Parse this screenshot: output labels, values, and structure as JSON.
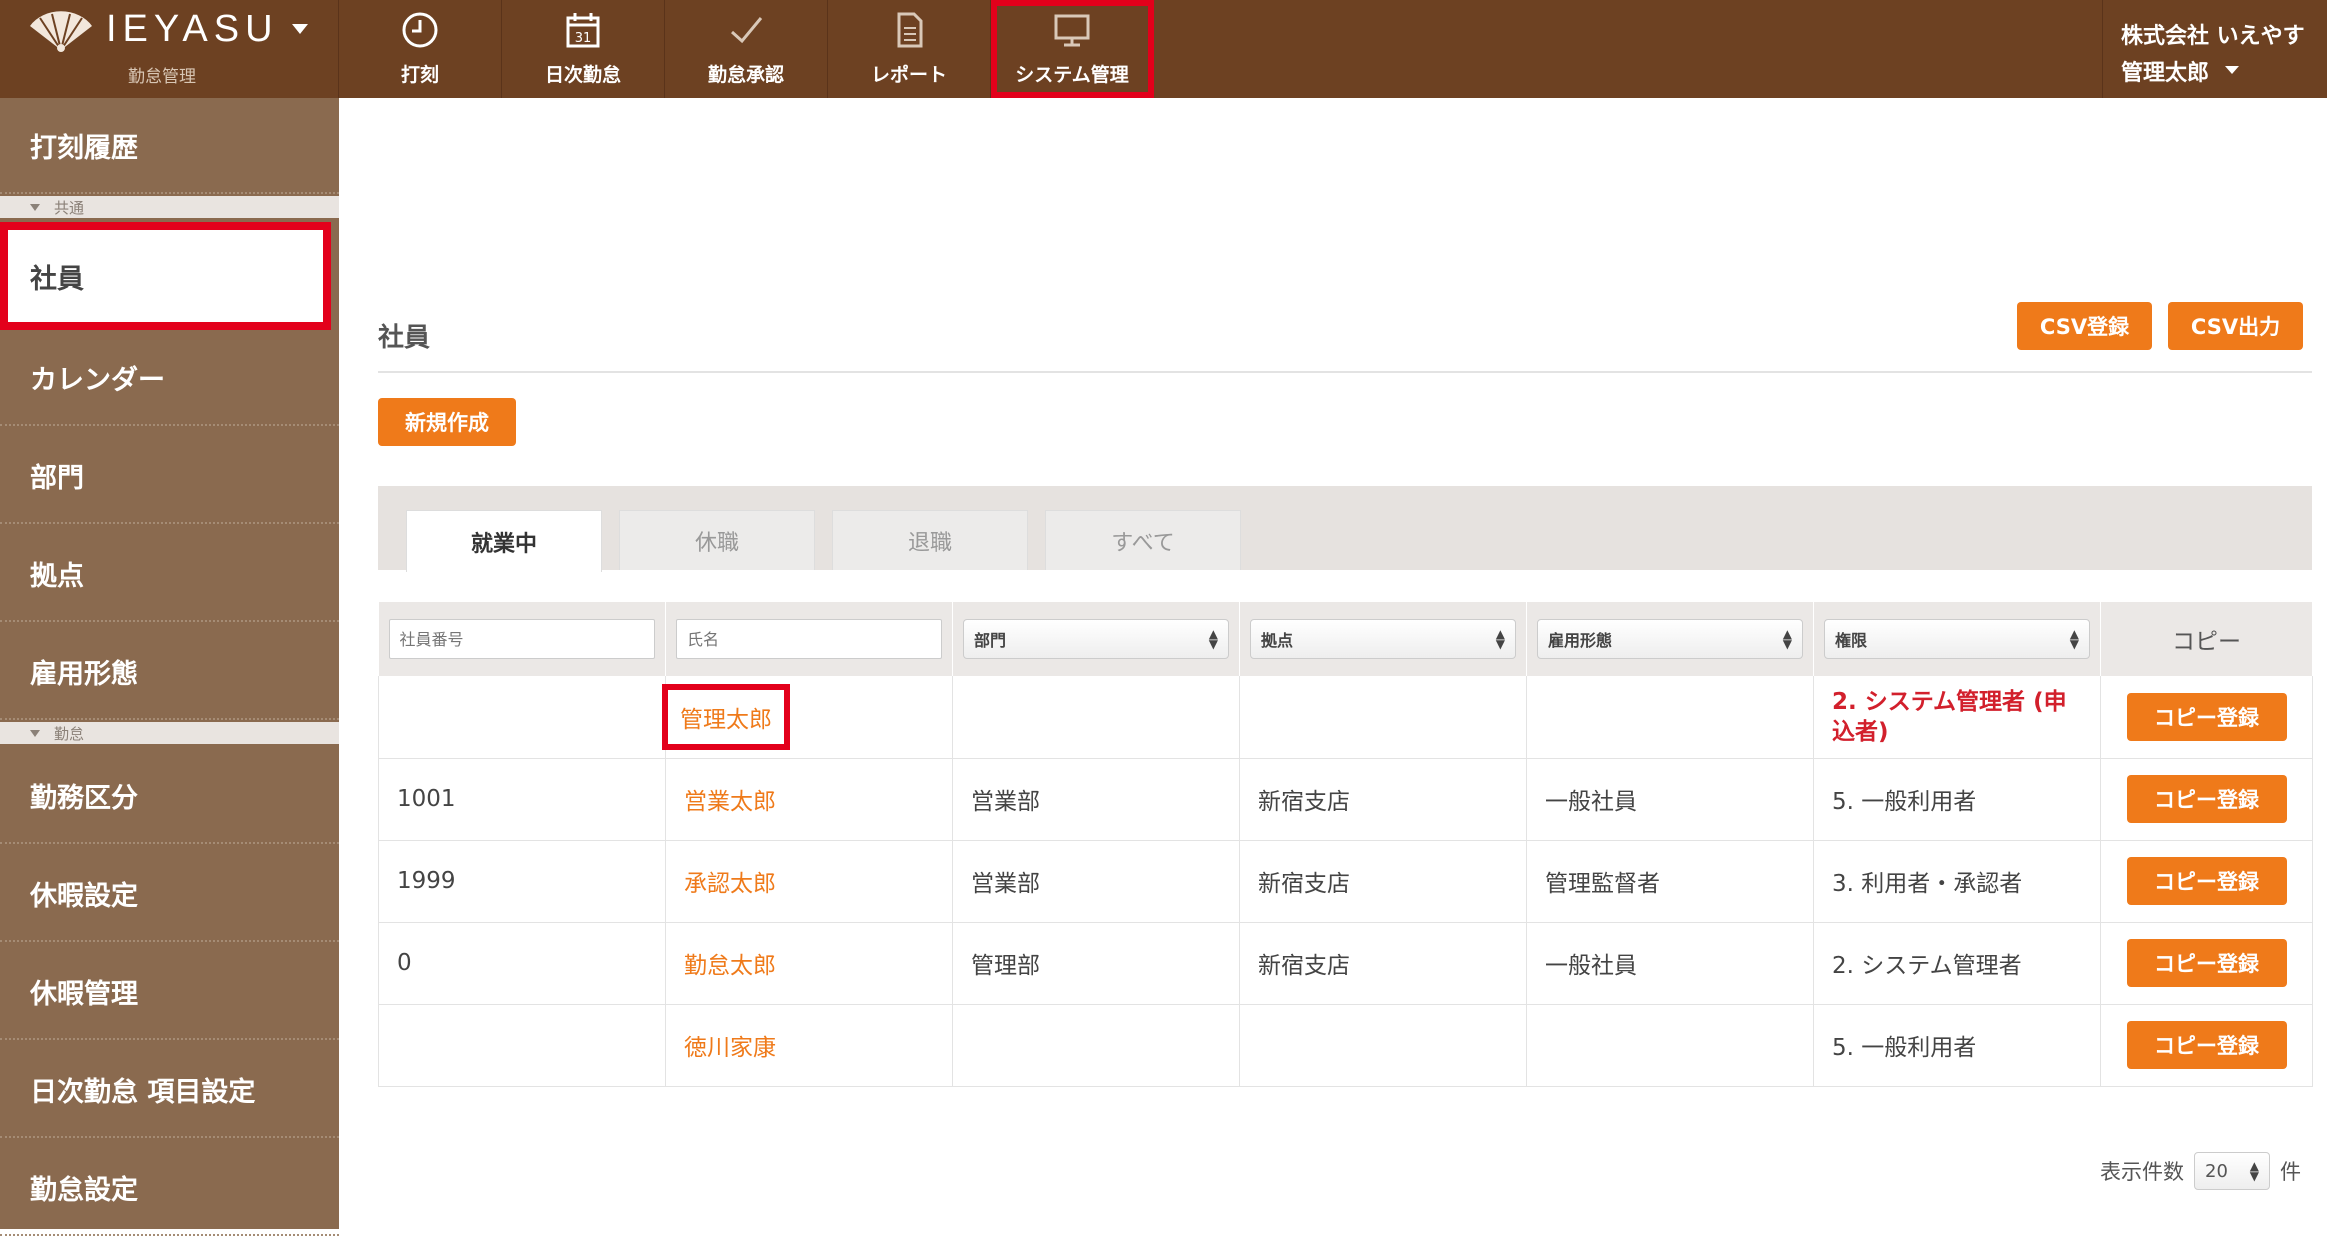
{
  "brand": {
    "name": "IEYASU",
    "subtitle": "勤怠管理"
  },
  "nav": [
    {
      "label": "打刻",
      "icon": "clock-icon"
    },
    {
      "label": "日次勤怠",
      "icon": "calendar-icon",
      "calendar_day": "31"
    },
    {
      "label": "勤怠承認",
      "icon": "check-icon"
    },
    {
      "label": "レポート",
      "icon": "document-icon"
    },
    {
      "label": "システム管理",
      "icon": "monitor-icon",
      "active": true
    }
  ],
  "user": {
    "company": "株式会社 いえやす",
    "name": "管理太郎"
  },
  "sidebar": {
    "top_item": "打刻履歴",
    "section_common": "共通",
    "items_common": [
      "社員",
      "カレンダー",
      "部門",
      "拠点",
      "雇用形態"
    ],
    "section_attendance": "勤怠",
    "items_attendance": [
      "勤務区分",
      "休暇設定",
      "休暇管理",
      "日次勤怠 項目設定",
      "勤怠設定"
    ]
  },
  "page": {
    "title": "社員",
    "csv_import": "CSV登録",
    "csv_export": "CSV出力",
    "new_button": "新規作成"
  },
  "tabs": [
    "就業中",
    "休職",
    "退職",
    "すべて"
  ],
  "filters": {
    "employee_no_placeholder": "社員番号",
    "name_placeholder": "氏名",
    "department": "部門",
    "location": "拠点",
    "employment_type": "雇用形態",
    "authority": "権限",
    "copy_header": "コピー"
  },
  "rows": [
    {
      "no": "",
      "name": "管理太郎",
      "dept": "",
      "location": "",
      "type": "",
      "role": "2. システム管理者 (申込者)",
      "copy": "コピー登録"
    },
    {
      "no": "1001",
      "name": "営業太郎",
      "dept": "営業部",
      "location": "新宿支店",
      "type": "一般社員",
      "role": "5. 一般利用者",
      "copy": "コピー登録"
    },
    {
      "no": "1999",
      "name": "承認太郎",
      "dept": "営業部",
      "location": "新宿支店",
      "type": "管理監督者",
      "role": "3. 利用者・承認者",
      "copy": "コピー登録"
    },
    {
      "no": "0",
      "name": "勤怠太郎",
      "dept": "管理部",
      "location": "新宿支店",
      "type": "一般社員",
      "role": "2. システム管理者",
      "copy": "コピー登録"
    },
    {
      "no": "",
      "name": "徳川家康",
      "dept": "",
      "location": "",
      "type": "",
      "role": "5. 一般利用者",
      "copy": "コピー登録"
    }
  ],
  "pager": {
    "label": "表示件数",
    "value": "20",
    "unit": "件"
  },
  "colors": {
    "topbar": "#6d4122",
    "sidebar": "#8a6a4f",
    "accent": "#ef7a1a",
    "highlight": "#e3001b"
  }
}
